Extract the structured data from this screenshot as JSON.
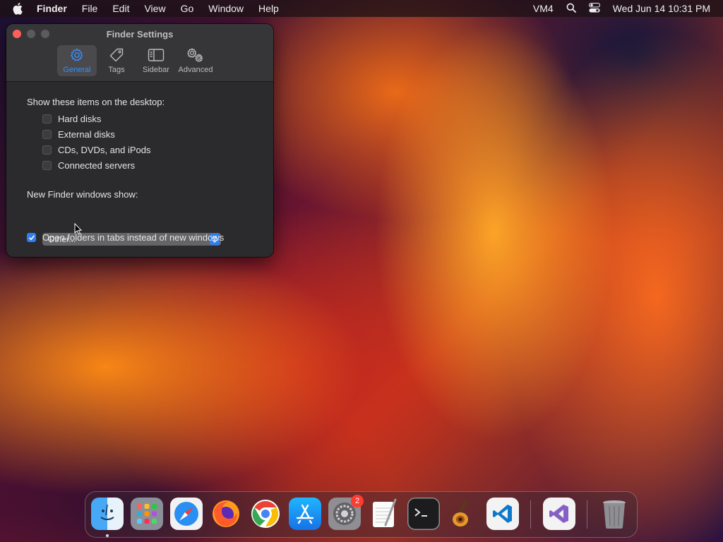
{
  "menubar": {
    "app_name": "Finder",
    "items": [
      "File",
      "Edit",
      "View",
      "Go",
      "Window",
      "Help"
    ],
    "vm_label": "VM4",
    "clock": "Wed Jun 14  10:31 PM"
  },
  "window": {
    "title": "Finder Settings",
    "tabs": [
      {
        "label": "General",
        "icon": "gear-icon",
        "active": true
      },
      {
        "label": "Tags",
        "icon": "tag-icon",
        "active": false
      },
      {
        "label": "Sidebar",
        "icon": "sidebar-icon",
        "active": false
      },
      {
        "label": "Advanced",
        "icon": "gears-icon",
        "active": false
      }
    ],
    "desktop_section": {
      "label": "Show these items on the desktop:",
      "items": [
        {
          "label": "Hard disks",
          "checked": false
        },
        {
          "label": "External disks",
          "checked": false
        },
        {
          "label": "CDs, DVDs, and iPods",
          "checked": false
        },
        {
          "label": "Connected servers",
          "checked": false
        }
      ]
    },
    "new_window_section": {
      "label": "New Finder windows show:",
      "selected": "Other..."
    },
    "open_in_tabs": {
      "label": "Open folders in tabs instead of new windows",
      "checked": true
    }
  },
  "dock": {
    "settings_badge": "2",
    "apps": [
      "finder",
      "launchpad",
      "safari",
      "firefox",
      "chrome",
      "app-store",
      "system-settings",
      "textedit",
      "terminal",
      "garageband",
      "vscode",
      "visual-studio",
      "trash"
    ]
  },
  "colors": {
    "accent": "#2f7ff0",
    "close": "#fe5f57",
    "badge": "#ff3b30"
  }
}
